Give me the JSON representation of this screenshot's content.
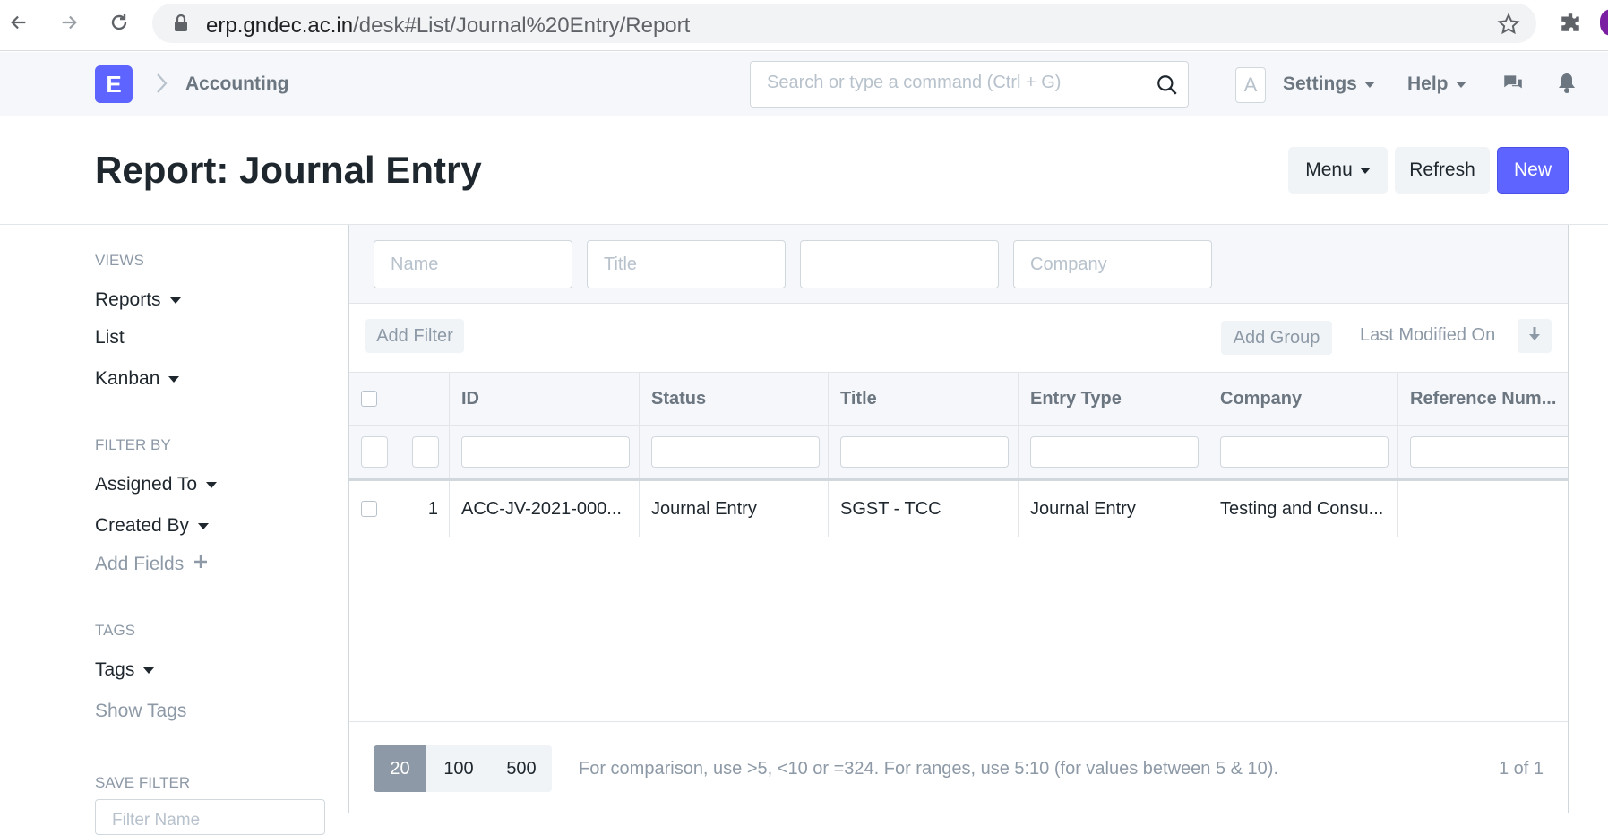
{
  "browser": {
    "url_host": "erp.gndec.ac.in",
    "url_path": "/desk#List/Journal%20Entry/Report"
  },
  "navbar": {
    "logo_letter": "E",
    "breadcrumb": "Accounting",
    "search_placeholder": "Search or type a command (Ctrl + G)",
    "avatar_letter": "A",
    "settings_label": "Settings",
    "help_label": "Help"
  },
  "page": {
    "title": "Report: Journal Entry",
    "menu_label": "Menu",
    "refresh_label": "Refresh",
    "new_label": "New"
  },
  "sidebar": {
    "views_heading": "VIEWS",
    "views": [
      "Reports",
      "List",
      "Kanban"
    ],
    "filter_heading": "FILTER BY",
    "filters": [
      "Assigned To",
      "Created By"
    ],
    "add_fields": "Add Fields",
    "tags_heading": "TAGS",
    "tags_label": "Tags",
    "show_tags": "Show Tags",
    "save_filter_heading": "SAVE FILTER",
    "filter_name_placeholder": "Filter Name"
  },
  "standard_filters": {
    "name_placeholder": "Name",
    "title_placeholder": "Title",
    "third_placeholder": "",
    "company_placeholder": "Company"
  },
  "filter_bar": {
    "add_filter": "Add Filter",
    "add_group": "Add Group",
    "sort_label": "Last Modified On"
  },
  "table": {
    "columns": [
      "ID",
      "Status",
      "Title",
      "Entry Type",
      "Company",
      "Reference Num..."
    ],
    "rows": [
      {
        "index": "1",
        "id": "ACC-JV-2021-000...",
        "status": "Journal Entry",
        "title": "SGST - TCC",
        "entry_type": "Journal Entry",
        "company": "Testing and Consu...",
        "reference": ""
      }
    ]
  },
  "footer": {
    "page_lengths": [
      "20",
      "100",
      "500"
    ],
    "active_page_length": "20",
    "help_text": "For comparison, use >5, <10 or =324. For ranges, use 5:10 (for values between 5 & 10).",
    "page_count": "1 of 1"
  },
  "colors": {
    "primary": "#5e64ff",
    "muted": "#8d99a6"
  }
}
